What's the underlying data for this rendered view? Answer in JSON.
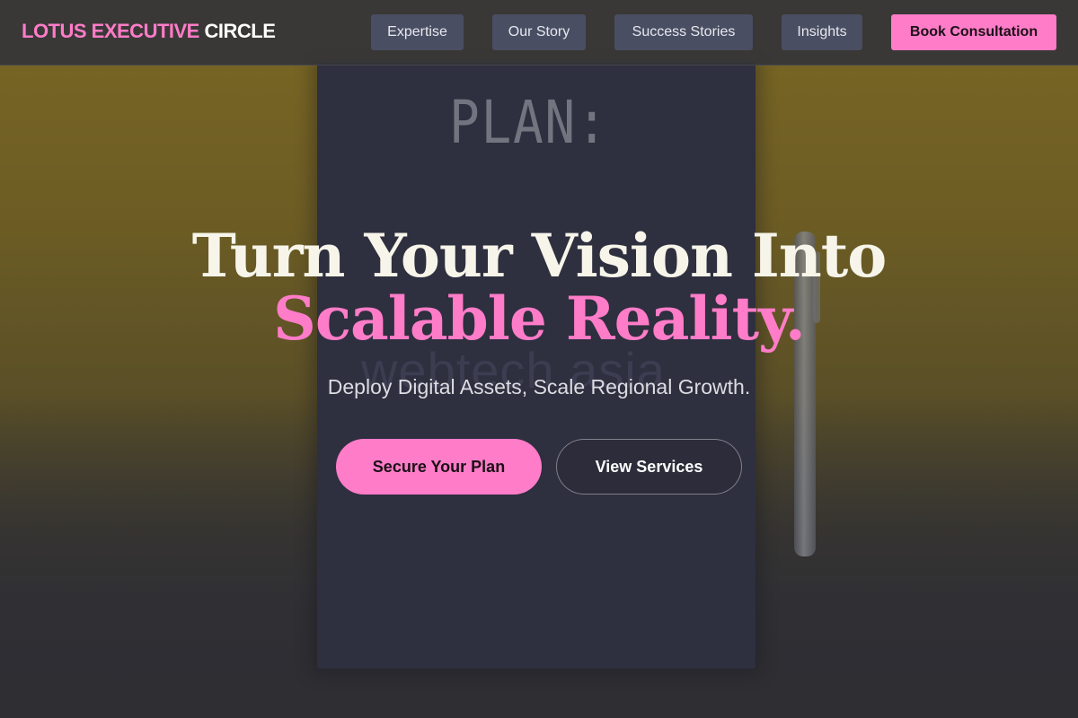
{
  "brand": {
    "accent_text": "LOTUS EXECUTIVE",
    "plain_text": "CIRCLE"
  },
  "nav": {
    "items": [
      {
        "label": "Expertise"
      },
      {
        "label": "Our Story"
      },
      {
        "label": "Success Stories"
      },
      {
        "label": "Insights"
      }
    ],
    "cta_label": "Book Consultation"
  },
  "hero": {
    "background_photo": {
      "notepad_text": "PLAN:",
      "watermark_text": "webtech asia"
    },
    "title_line1": "Turn Your Vision Into",
    "title_line2": "Scalable Reality.",
    "subtitle": "Deploy Digital Assets, Scale Regional Growth.",
    "primary_button": "Secure Your Plan",
    "secondary_button": "View Services"
  },
  "colors": {
    "accent": "#ff7cc8",
    "nav_button_bg": "#4a4e62",
    "header_bg": "#343438"
  }
}
